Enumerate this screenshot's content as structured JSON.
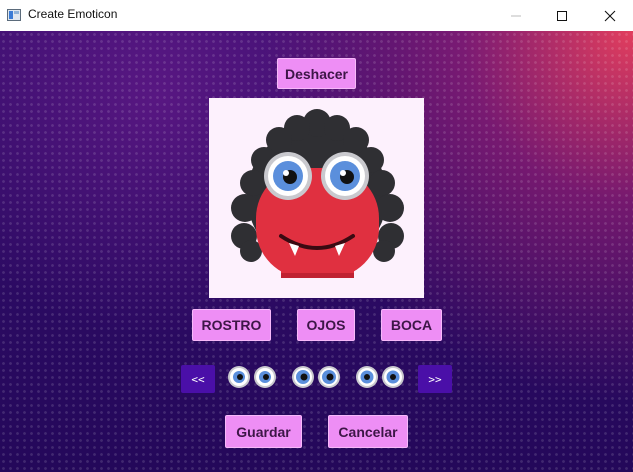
{
  "window": {
    "title": "Create Emoticon"
  },
  "toolbar": {
    "undo_label": "Deshacer"
  },
  "parts": {
    "face_label": "ROSTRO",
    "eyes_label": "OJOS",
    "mouth_label": "BOCA"
  },
  "selector": {
    "prev_label": "<<",
    "next_label": ">>",
    "options": [
      "eyes-blue-1",
      "eyes-blue-2",
      "eyes-blue-3"
    ]
  },
  "actions": {
    "save_label": "Guardar",
    "cancel_label": "Cancelar"
  },
  "colors": {
    "accent_button": "#ee8ef5",
    "nav_button": "#4a0fa8",
    "monster_body": "#e03040",
    "fur": "#2f2f33"
  }
}
